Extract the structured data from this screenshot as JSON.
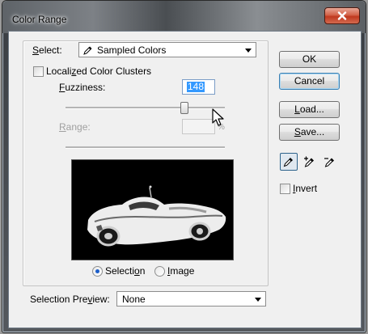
{
  "window": {
    "title": "Color Range"
  },
  "select": {
    "label": "Select:",
    "value": "Sampled Colors",
    "icon": "eyedropper-icon"
  },
  "localized": {
    "label": "Localized Color Clusters",
    "checked": false
  },
  "fuzziness": {
    "label": "Fuzziness:",
    "value": "148"
  },
  "range": {
    "label": "Range:",
    "value": "",
    "unit": "%"
  },
  "preview_mode": {
    "selection_label": "Selection",
    "image_label": "Image",
    "selected": "Selection"
  },
  "selection_preview": {
    "label": "Selection Preview:",
    "value": "None"
  },
  "buttons": {
    "ok": "OK",
    "cancel": "Cancel",
    "load": "Load...",
    "save": "Save..."
  },
  "invert": {
    "label": "Invert",
    "checked": false
  },
  "colors": {
    "accent": "#3399ff",
    "close": "#c0391f"
  }
}
